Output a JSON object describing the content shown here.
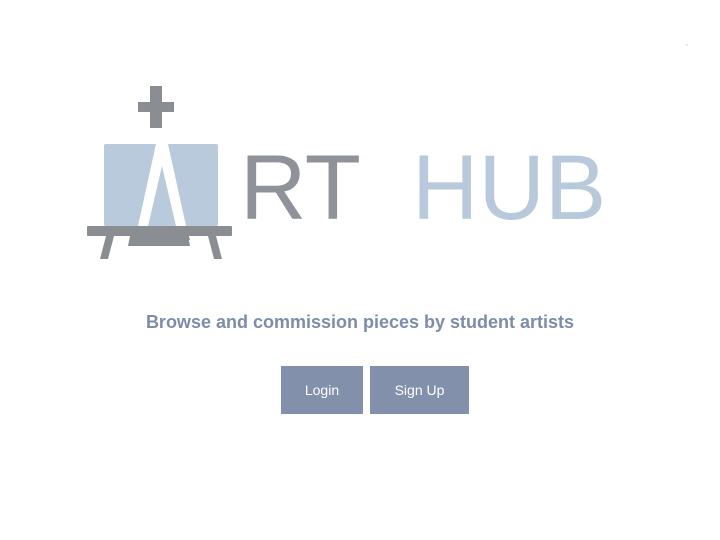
{
  "brand": {
    "logo_text": "ARTHUB",
    "logo_text_parts": {
      "first": "RT",
      "second": "HUB"
    },
    "colors": {
      "canvas": "#b9cadc",
      "easel": "#8a8d91",
      "rt": "#8f9399",
      "hub": "#b8c9db"
    }
  },
  "hero": {
    "tagline": "Browse and commission pieces by student artists"
  },
  "actions": {
    "login_label": "Login",
    "signup_label": "Sign Up",
    "button_color": "#8290ab"
  },
  "icons": {
    "logo": "easel-icon"
  }
}
